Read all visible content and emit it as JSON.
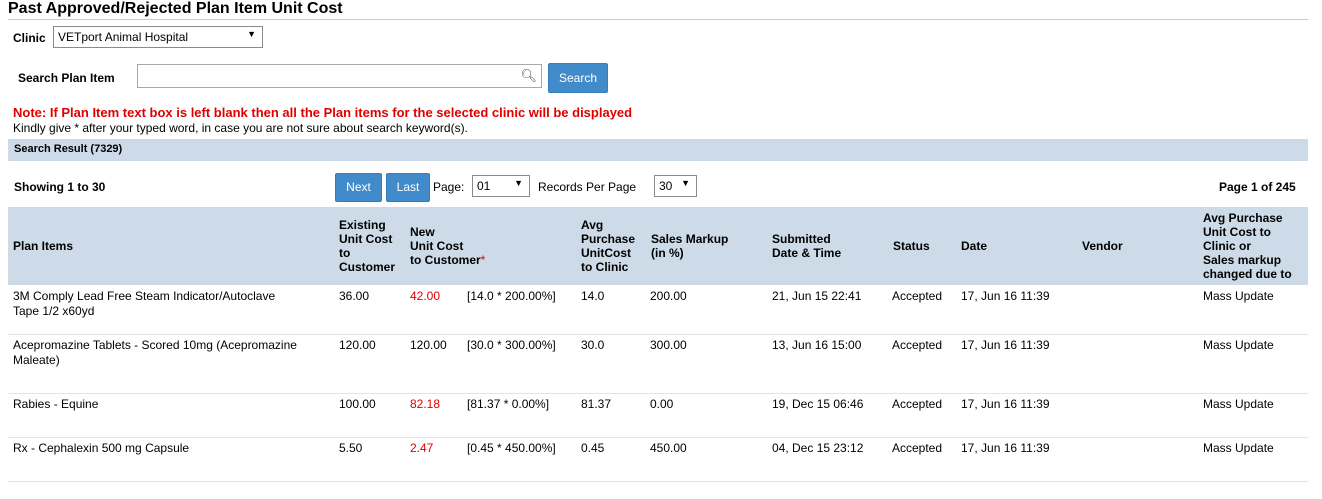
{
  "page_title": "Past Approved/Rejected Plan Item Unit Cost",
  "clinic": {
    "label": "Clinic",
    "selected": "VETport Animal Hospital"
  },
  "search": {
    "label": "Search Plan Item",
    "value": "",
    "button": "Search"
  },
  "note": "Note: If Plan Item text box is left blank then all the Plan items for the selected clinic will be displayed",
  "hint": "Kindly give * after your typed word, in case you are not sure about search keyword(s).",
  "result_header": "Search Result (7329)",
  "pager": {
    "showing": "Showing 1 to 30",
    "next": "Next",
    "last": "Last",
    "page_label": "Page:",
    "page_value": "01",
    "records_label": "Records Per Page",
    "records_value": "30",
    "page_of": "Page 1 of 245"
  },
  "columns": {
    "plan_items": "Plan Items",
    "existing": [
      "Existing",
      "Unit Cost",
      "to",
      "Customer"
    ],
    "new_cost": [
      "New",
      "Unit Cost",
      "to Customer"
    ],
    "new_cost_req": "*",
    "avg_purchase": [
      "Avg",
      "Purchase",
      "UnitCost",
      "to Clinic"
    ],
    "sales_markup": [
      "Sales Markup",
      "(in %)"
    ],
    "submitted": [
      "Submitted",
      "Date & Time"
    ],
    "status": "Status",
    "date": "Date",
    "vendor": "Vendor",
    "changed_due": [
      "Avg Purchase",
      "Unit Cost to",
      "Clinic or",
      "Sales markup",
      "changed due to"
    ]
  },
  "rows": [
    {
      "item": [
        "3M Comply Lead Free Steam Indicator/Autoclave",
        "Tape 1/2 x60yd"
      ],
      "existing": "36.00",
      "new": "42.00",
      "new_red": true,
      "formula": "[14.0 * 200.00%]",
      "avg": "14.0",
      "markup": "200.00",
      "submitted": "21, Jun 15 22:41",
      "status": "Accepted",
      "date": "17, Jun 16 11:39",
      "vendor": "",
      "reason": "Mass Update"
    },
    {
      "item": [
        "Acepromazine Tablets - Scored 10mg (Acepromazine",
        "Maleate)"
      ],
      "existing": "120.00",
      "new": "120.00",
      "new_red": false,
      "formula": "[30.0 * 300.00%]",
      "avg": "30.0",
      "markup": "300.00",
      "submitted": "13, Jun 16 15:00",
      "status": "Accepted",
      "date": "17, Jun 16 11:39",
      "vendor": "",
      "reason": "Mass Update"
    },
    {
      "item": [
        "Rabies - Equine"
      ],
      "existing": "100.00",
      "new": "82.18",
      "new_red": true,
      "formula": "[81.37 * 0.00%]",
      "avg": "81.37",
      "markup": "0.00",
      "submitted": "19, Dec 15 06:46",
      "status": "Accepted",
      "date": "17, Jun 16 11:39",
      "vendor": "",
      "reason": "Mass Update"
    },
    {
      "item": [
        "Rx - Cephalexin 500 mg Capsule"
      ],
      "existing": "5.50",
      "new": "2.47",
      "new_red": true,
      "formula": "[0.45 * 450.00%]",
      "avg": "0.45",
      "markup": "450.00",
      "submitted": "04, Dec 15 23:12",
      "status": "Accepted",
      "date": "17, Jun 16 11:39",
      "vendor": "",
      "reason": "Mass Update"
    }
  ]
}
